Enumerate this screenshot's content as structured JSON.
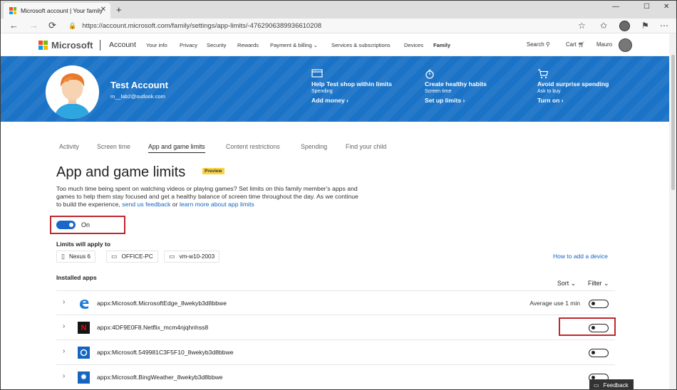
{
  "browser": {
    "tab_title": "Microsoft account | Your family",
    "url": "https://account.microsoft.com/family/settings/app-limits/-4762906389936610208"
  },
  "header": {
    "brand": "Microsoft",
    "account_label": "Account",
    "nav": [
      "Your info",
      "Privacy",
      "Security",
      "Rewards",
      "Payment & billing",
      "Services & subscriptions",
      "Devices",
      "Family"
    ],
    "search_label": "Search",
    "cart_label": "Cart",
    "user_name": "Mauro"
  },
  "banner": {
    "name": "Test Account",
    "email": "m__lab2@outlook.com",
    "features": [
      {
        "icon": "card-icon",
        "title": "Help Test shop within limits",
        "subtitle": "Spending",
        "link": "Add money"
      },
      {
        "icon": "stopwatch-icon",
        "title": "Create healthy habits",
        "subtitle": "Screen time",
        "link": "Set up limits"
      },
      {
        "icon": "cart-icon",
        "title": "Avoid surprise spending",
        "subtitle": "Ask to buy",
        "link": "Turn on"
      }
    ]
  },
  "subnav": [
    "Activity",
    "Screen time",
    "App and game limits",
    "Content restrictions",
    "Spending",
    "Find your child"
  ],
  "page": {
    "title": "App and game limits",
    "badge": "Preview",
    "description": "Too much time being spent on watching videos or playing games? Set limits on this family member's apps and games to help them stay focused and get a healthy balance of screen time throughout the day. As we continue to build the experience,",
    "link_feedback": "send us feedback",
    "or": "or",
    "link_learn": "learn more about app limits",
    "toggle_label": "On",
    "limits_label": "Limits will apply to",
    "devices": [
      "Nexus 6",
      "OFFICE-PC",
      "vm-w10-2003"
    ],
    "add_device": "How to add a device",
    "installed_label": "Installed apps",
    "sort_label": "Sort",
    "filter_label": "Filter"
  },
  "apps": [
    {
      "name": "appx:Microsoft.MicrosoftEdge_8wekyb3d8bbwe",
      "avg": "Average use 1 min",
      "enabled": false
    },
    {
      "name": "appx:4DF9E0F8.Netflix_mcm4njqhnhss8",
      "avg": "",
      "enabled": false
    },
    {
      "name": "appx:Microsoft.549981C3F5F10_8wekyb3d8bbwe",
      "avg": "",
      "enabled": false
    },
    {
      "name": "appx:Microsoft.BingWeather_8wekyb3d8bbwe",
      "avg": "",
      "enabled": false
    }
  ],
  "feedback_label": "Feedback",
  "colors": {
    "banner": "#1a73c6",
    "accent": "#1b66c9",
    "highlight": "#c0262c",
    "link": "#1565c0"
  }
}
